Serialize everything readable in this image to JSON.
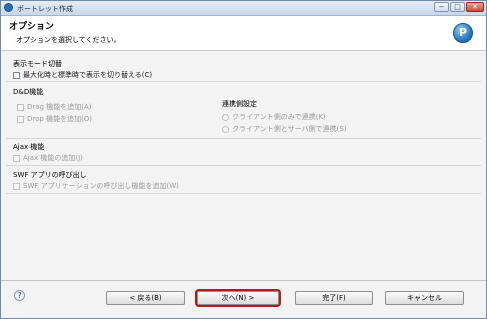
{
  "window": {
    "title": "ポートレット作成",
    "min_label": "−",
    "max_label": "□",
    "close_label": "✕"
  },
  "header": {
    "title": "オプション",
    "description": "オプションを選択してください。",
    "logo_letter": "P"
  },
  "display_mode": {
    "heading": "表示モード切替",
    "checkbox_label": "最大化時と標準時で表示を切り替える(C)"
  },
  "dnd": {
    "heading": "D&D機能",
    "drag_label": "Drag 機能を追加(A)",
    "drop_label": "Drop 機能を追加(O)",
    "link_heading": "連携側設定",
    "radio_client_only": "クライアント側のみで連携(K)",
    "radio_client_server": "クライアント側とサーバ側で連携(S)"
  },
  "ajax": {
    "heading": "Ajax 機能",
    "checkbox_label": "Ajax 機能の追加(J)"
  },
  "swf": {
    "heading": "SWF アプリの呼び出し",
    "checkbox_label": "SWF アプリケーションの呼び出し機能を追加(W)"
  },
  "footer": {
    "help_label": "?",
    "back_label": "< 戻る(B)",
    "next_label": "次へ(N) >",
    "finish_label": "完了(F)",
    "cancel_label": "キャンセル"
  }
}
